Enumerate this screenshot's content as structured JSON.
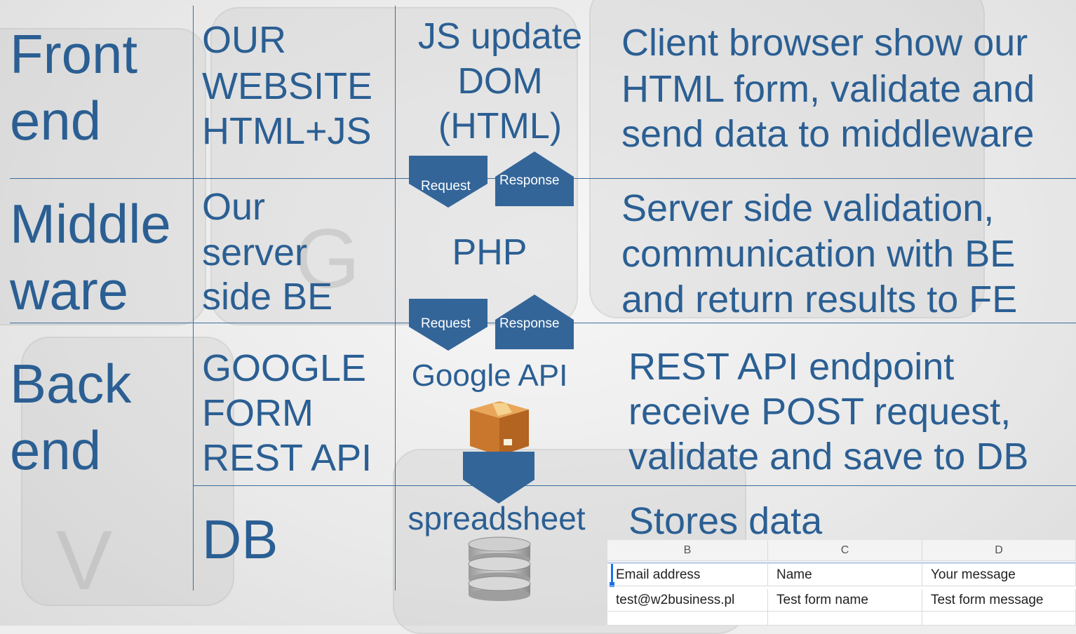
{
  "layers": {
    "frontend": {
      "title_line1": "Front",
      "title_line2": "end",
      "component": [
        "OUR",
        "WEBSITE",
        "HTML+JS"
      ],
      "tech": [
        "JS update",
        "DOM",
        "(HTML)"
      ],
      "description": [
        "Client browser show our",
        "HTML form, validate and",
        "send data to middleware"
      ]
    },
    "middleware": {
      "title_line1": "Middle",
      "title_line2": "ware",
      "component": [
        "Our",
        "server",
        "side BE"
      ],
      "tech": "PHP",
      "description": [
        "Server side validation,",
        "communication with BE",
        "and return results to FE"
      ]
    },
    "backend": {
      "title_line1": "Back",
      "title_line2": "end",
      "component": [
        "GOOGLE",
        "FORM",
        "REST API"
      ],
      "tech": "Google API",
      "description": [
        "REST API endpoint",
        "receive POST request,",
        "validate and save to DB"
      ]
    },
    "db": {
      "component": "DB",
      "tech": "spreadsheet",
      "description": "Stores data"
    }
  },
  "arrows": {
    "top_request": "Request",
    "top_response": "Response",
    "mid_request": "Request",
    "mid_response": "Response"
  },
  "icons": [
    "box-icon",
    "database-icon",
    "chevron-down-icon"
  ],
  "colors": {
    "text": "#2b5f93",
    "chevron": "#336599",
    "lines": "#3b6d9c"
  },
  "spreadsheet": {
    "columns": [
      "B",
      "C",
      "D"
    ],
    "rows": [
      [
        "Email address",
        "Name",
        "Your message"
      ],
      [
        "test@w2business.pl",
        "Test form name",
        "Test form message"
      ]
    ]
  }
}
